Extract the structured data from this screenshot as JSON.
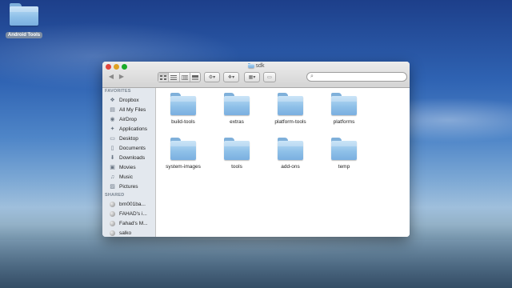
{
  "desktop": {
    "icon_label": "Android Tools"
  },
  "window": {
    "title": "sdk",
    "nav": {
      "back": "◀",
      "forward": "▶"
    },
    "toolbar": {
      "view_modes": [
        "icon-view",
        "list-view",
        "column-view",
        "coverflow-view"
      ],
      "action_icon": "gear-icon",
      "dropbox_icon": "dropbox-icon",
      "arrange_icon": "arrange-icon",
      "share_icon": "share-icon"
    },
    "search": {
      "placeholder": ""
    }
  },
  "sidebar": {
    "favorites_header": "FAVORITES",
    "favorites": [
      {
        "label": "Dropbox",
        "icon": "dropbox-icon"
      },
      {
        "label": "All My Files",
        "icon": "all-files-icon"
      },
      {
        "label": "AirDrop",
        "icon": "airdrop-icon"
      },
      {
        "label": "Applications",
        "icon": "applications-icon"
      },
      {
        "label": "Desktop",
        "icon": "desktop-icon"
      },
      {
        "label": "Documents",
        "icon": "documents-icon"
      },
      {
        "label": "Downloads",
        "icon": "downloads-icon"
      },
      {
        "label": "Movies",
        "icon": "movies-icon"
      },
      {
        "label": "Music",
        "icon": "music-icon"
      },
      {
        "label": "Pictures",
        "icon": "pictures-icon"
      }
    ],
    "shared_header": "SHARED",
    "shared": [
      {
        "label": "brn001ba...",
        "icon": "computer-icon"
      },
      {
        "label": "FAHAD's i...",
        "icon": "computer-icon"
      },
      {
        "label": "Fahad's M...",
        "icon": "computer-icon"
      },
      {
        "label": "salko",
        "icon": "computer-icon"
      }
    ]
  },
  "folders": [
    "build-tools",
    "extras",
    "platform-tools",
    "platforms",
    "system-images",
    "tools",
    "add-ons",
    "temp"
  ],
  "colors": {
    "folder_light": "#b9dbf5",
    "folder_dark": "#7aafe0",
    "sidebar_bg": "#e3e8ee",
    "close": "#e0443e",
    "minimize": "#dea123",
    "zoom": "#1aab29"
  }
}
